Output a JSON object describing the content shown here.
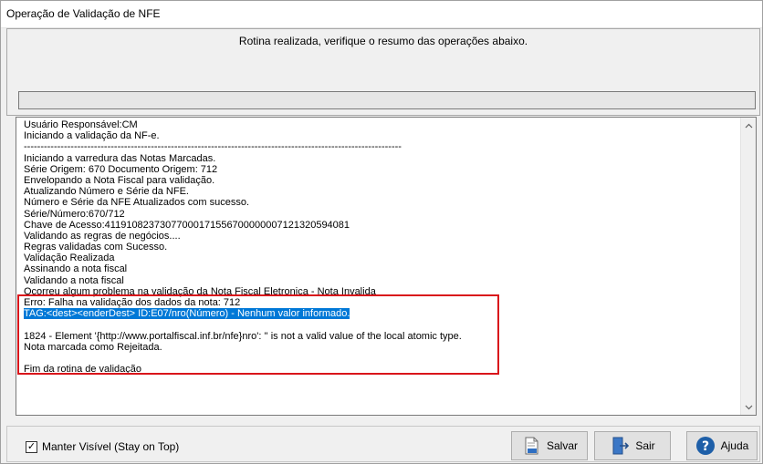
{
  "window": {
    "title": "Operação de Validação de NFE"
  },
  "summary": {
    "text": "Rotina realizada, verifique o resumo das operações abaixo."
  },
  "progress": {
    "value": 0
  },
  "log": {
    "lines": [
      "Usuário Responsável:CM",
      "Iniciando a validação da NF-e.",
      "-----------------------------------------------------------------------------------------------------------------",
      "Iniciando a varredura das Notas Marcadas.",
      "Série Origem: 670 Documento Origem: 712",
      "Envelopando a Nota Fiscal para validação.",
      "Atualizando Número e Série da NFE.",
      "Número e Série da NFE Atualizados com sucesso.",
      "Série/Número:670/712",
      "Chave de Acesso:41191082373077000171556700000007121320594081",
      "Validando as regras de negócios....",
      "Regras validadas com Sucesso.",
      "Validação Realizada",
      "Assinando a nota fiscal",
      "Validando a nota fiscal",
      "Ocorreu algum problema na validação da Nota Fiscal Eletronica - Nota Invalida",
      "Erro: Falha na validação dos dados da nota: 712",
      "TAG:<dest><enderDest> ID:E07/nro(Número) - Nenhum valor informado.",
      "",
      "1824 - Element '{http://www.portalfiscal.inf.br/nfe}nro': '' is not a valid value of the local atomic type.",
      "Nota marcada como Rejeitada.",
      "",
      "Fim da rotina de validação"
    ]
  },
  "footer": {
    "stay_on_top_label": "Manter Visível (Stay on Top)",
    "stay_on_top_checked": "✓",
    "salvar_label": "Salvar",
    "sair_label": "Sair",
    "ajuda_label": "Ajuda"
  },
  "icons": {
    "check": "check-icon",
    "salvar": "save-log-icon",
    "sair": "exit-icon",
    "ajuda": "help-icon",
    "scroll_up": "chevron-up-icon",
    "scroll_down": "chevron-down-icon"
  },
  "colors": {
    "highlight": "#0078d7",
    "error_border": "#d9151b",
    "help_blue": "#1e5fa8"
  }
}
